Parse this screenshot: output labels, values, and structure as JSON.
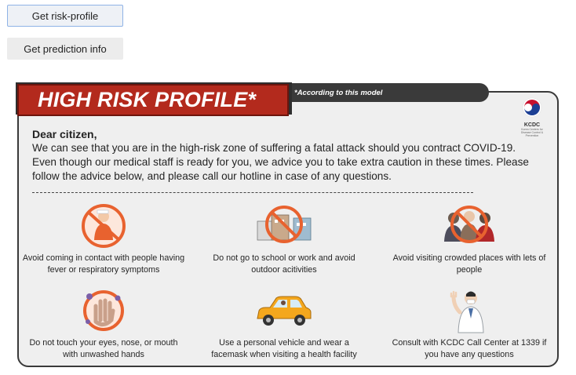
{
  "buttons": {
    "risk_profile": "Get risk-profile",
    "prediction_info": "Get prediction info"
  },
  "infographic": {
    "title": "HIGH RISK PROFILE*",
    "footnote_tag": "*According to this model",
    "logo": {
      "name": "KCDC",
      "subtitle": "Korea Centers for Disease Control & Prevention"
    },
    "letter": {
      "greeting": "Dear citizen,",
      "body": "We can see that you are in the high-risk zone of suffering a fatal attack should you contract COVID-19. Even though our medical staff is ready for you, we advice you to take extra caution in these times. Please follow the advice below, and please call our hotline in case of any questions."
    },
    "tips": [
      {
        "icon": "fever-contact-prohibited-icon",
        "caption": "Avoid coming in contact with people having fever or respiratory symptoms"
      },
      {
        "icon": "school-work-prohibited-icon",
        "caption": "Do not go to school or work and avoid outdoor acitivities"
      },
      {
        "icon": "crowd-prohibited-icon",
        "caption": "Avoid visiting crowded places with lets of people"
      },
      {
        "icon": "unwashed-hands-icon",
        "caption": "Do not touch your eyes, nose, or mouth with unwashed hands"
      },
      {
        "icon": "car-icon",
        "caption": "Use a personal vehicle and wear a facemask when visiting a health facility"
      },
      {
        "icon": "doctor-icon",
        "caption": "Consult with KCDC Call Center at 1339 if you have any questions"
      }
    ],
    "colors": {
      "title_red": "#b32a1d",
      "prohibit_orange": "#e8622f",
      "panel_border": "#3a3a3a"
    }
  }
}
